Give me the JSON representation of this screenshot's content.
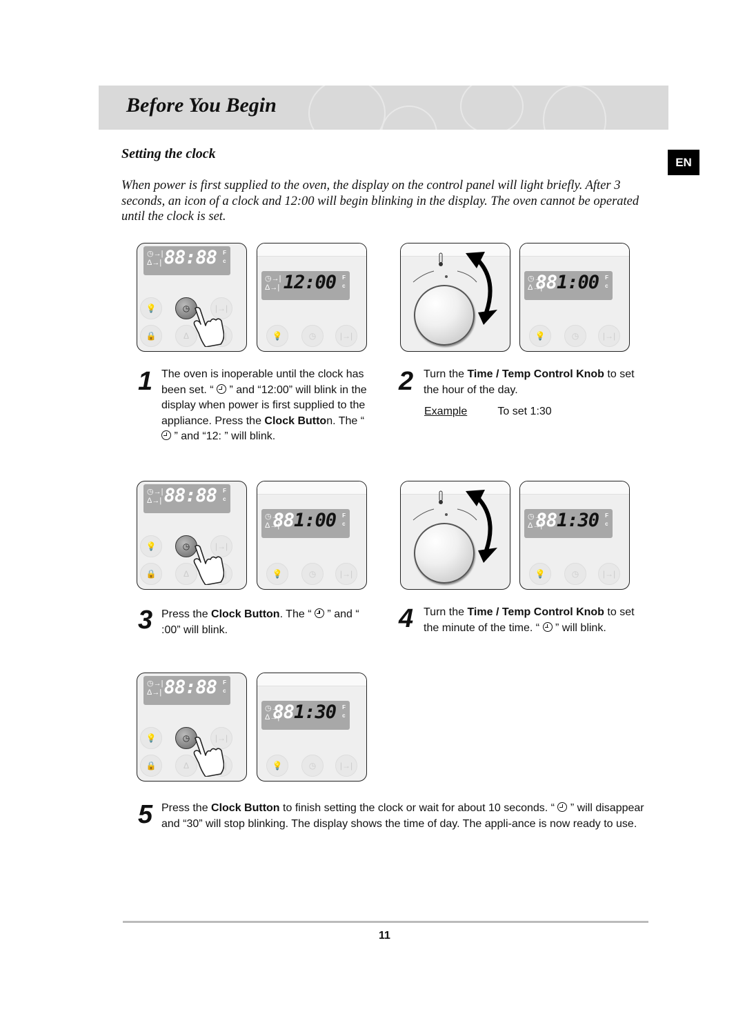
{
  "header": {
    "title": "Before You Begin",
    "language_badge": "EN"
  },
  "section": {
    "title": "Setting the clock",
    "intro": "When power is first supplied to the oven, the display on the control panel will light briefly. After 3 seconds, an icon of a clock and 12:00 will begin blinking in the display. The oven cannot be operated until the clock is set."
  },
  "displays": {
    "idle": {
      "ghost": "88:88",
      "lit": ""
    },
    "step1": {
      "ghost": "",
      "lit": "12:00"
    },
    "step2": {
      "ghost": "88",
      "lit": "1:00"
    },
    "step3": {
      "ghost": "88",
      "lit": "1:00"
    },
    "step4": {
      "ghost": "88",
      "lit": "1:30"
    },
    "step5": {
      "ghost": "88",
      "lit": "1:30"
    },
    "unit_f": "F",
    "unit_c": "c"
  },
  "icons": {
    "clock": "clock-icon",
    "bell": "bell-icon",
    "lamp": "lamp-icon",
    "lock": "lock-icon",
    "duration": "duration-icon",
    "end_time": "end-time-icon",
    "thermometer": "thermometer-icon",
    "hand": "pointing-hand-icon",
    "rotate_arrow": "rotate-arrow-icon"
  },
  "steps": [
    {
      "num": "1",
      "parts": [
        "The oven is inoperable until the clock has been set. “ ",
        " ” and “12:00” will blink in the display when power is first supplied to the appliance. Press the ",
        "Clock Butto",
        "n. The “ ",
        " ” and “12: ” will blink."
      ]
    },
    {
      "num": "2",
      "parts": [
        "Turn the ",
        "Time / Temp Control Knob",
        " to set the hour of the day."
      ]
    },
    {
      "num": "3",
      "parts": [
        "Press the ",
        "Clock Button",
        ". The “ ",
        " ” and “ :00” will blink."
      ]
    },
    {
      "num": "4",
      "parts": [
        "Turn the ",
        "Time / Temp Control Knob",
        " to set the minute of the time. “ ",
        " ” will blink."
      ]
    },
    {
      "num": "5",
      "parts": [
        "Press the ",
        "Clock Button",
        " to finish setting the clock or wait for about 10 seconds. “ ",
        " ” will disappear and “30” will stop blinking. The display shows the time of day. The appli-ance is now ready to use."
      ]
    }
  ],
  "example": {
    "label": "Example",
    "value": "To set 1:30"
  },
  "footer": {
    "page_number": "11"
  }
}
